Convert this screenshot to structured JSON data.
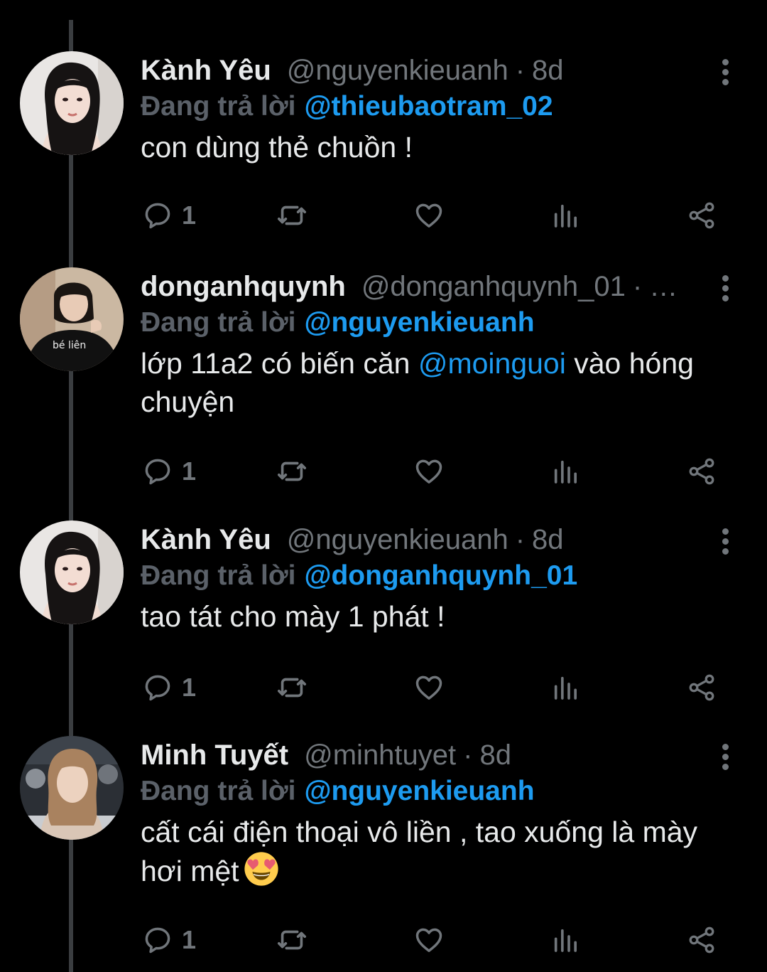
{
  "thread": {
    "tweets": [
      {
        "name": "Kành Yêu",
        "handle": "@nguyenkieuanh",
        "separator": "·",
        "time": "8d",
        "reply_prefix": "Đang trả lời",
        "reply_to": "@thieubaotram_02",
        "text": "con dùng thẻ chuồn !",
        "reply_count": "1",
        "avatar_icon": "avatar-girl-dark-hair"
      },
      {
        "name": "donganhquynh",
        "handle": "@donganhquynh_01",
        "separator": "·",
        "time": "…",
        "reply_prefix": "Đang trả lời",
        "reply_to": "@nguyenkieuanh",
        "text_before": "lớp 11a2 có biến căn ",
        "text_mention": "@moinguoi",
        "text_after": " vào hóng chuyện",
        "reply_count": "1",
        "avatar_icon": "avatar-girl-black-shirt",
        "avatar_shirt_text": "bé liên"
      },
      {
        "name": "Kành Yêu",
        "handle": "@nguyenkieuanh",
        "separator": "·",
        "time": "8d",
        "reply_prefix": "Đang trả lời",
        "reply_to": "@donganhquynh_01",
        "text": "tao tát cho mày 1 phát !",
        "reply_count": "1",
        "avatar_icon": "avatar-girl-dark-hair"
      },
      {
        "name": "Minh Tuyết",
        "handle": "@minhtuyet",
        "separator": "·",
        "time": "8d",
        "reply_prefix": "Đang trả lời",
        "reply_to": "@nguyenkieuanh",
        "text": "cất cái điện thoại vô liền , tao xuống là mày hơi mệt",
        "emoji": "heart-eyes-emoji",
        "reply_count": "1",
        "avatar_icon": "avatar-woman-blonde"
      }
    ]
  },
  "colors": {
    "background": "#000000",
    "text": "#e7e9ea",
    "muted": "#71767b",
    "link": "#1d9bf0",
    "thread_line": "#3a3d40"
  },
  "icons": {
    "reply": "reply-icon",
    "retweet": "retweet-icon",
    "like": "like-icon",
    "views": "views-icon",
    "share": "share-icon",
    "more": "more-options-icon"
  }
}
